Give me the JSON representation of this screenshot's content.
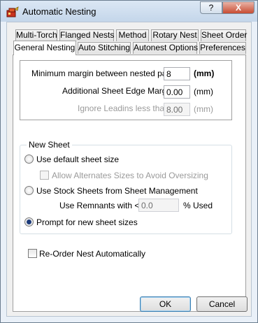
{
  "window": {
    "title": "Automatic Nesting",
    "help_label": "?",
    "close_label": "X"
  },
  "tabs_row1": [
    "Multi-Torch",
    "Flanged Nests",
    "Method",
    "Rotary Nest",
    "Sheet Order"
  ],
  "tabs_row2": [
    "General Nesting",
    "Auto Stitching",
    "Autonest Options",
    "Preferences"
  ],
  "active_tab": "General Nesting",
  "margins": {
    "min_margin_label": "Minimum margin between nested parts:",
    "min_margin_value": "8",
    "min_margin_unit": "(mm)",
    "edge_margin_label": "Additional Sheet Edge Margin",
    "edge_margin_value": "0.00",
    "edge_margin_unit": "(mm)",
    "ignore_leadins_label": "Ignore Leadins less than:",
    "ignore_leadins_value": "8.00",
    "ignore_leadins_unit": "(mm)"
  },
  "new_sheet": {
    "legend": "New Sheet",
    "option_default": "Use default sheet size",
    "allow_alternates": "Allow Alternates Sizes to Avoid Oversizing",
    "option_stock": "Use Stock Sheets from Sheet Management",
    "remnants_label": "Use Remnants with <=",
    "remnants_value": "0.0",
    "remnants_unit": "% Used",
    "option_prompt": "Prompt for new sheet sizes",
    "selected": "prompt"
  },
  "reorder_label": "Re-Order Nest Automatically",
  "buttons": {
    "ok": "OK",
    "cancel": "Cancel"
  }
}
